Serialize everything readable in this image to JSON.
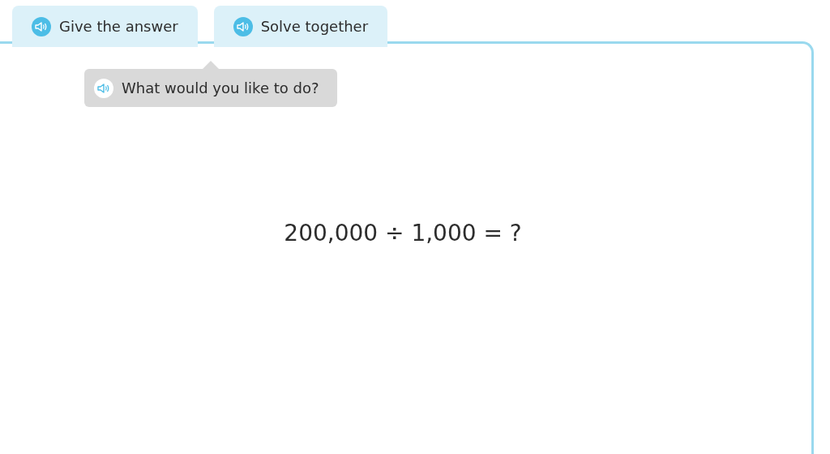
{
  "tabs": [
    {
      "label": "Give the answer"
    },
    {
      "label": "Solve together"
    }
  ],
  "prompt": {
    "text": "What would you like to do?"
  },
  "question": "200,000 ÷ 1,000 = ?"
}
